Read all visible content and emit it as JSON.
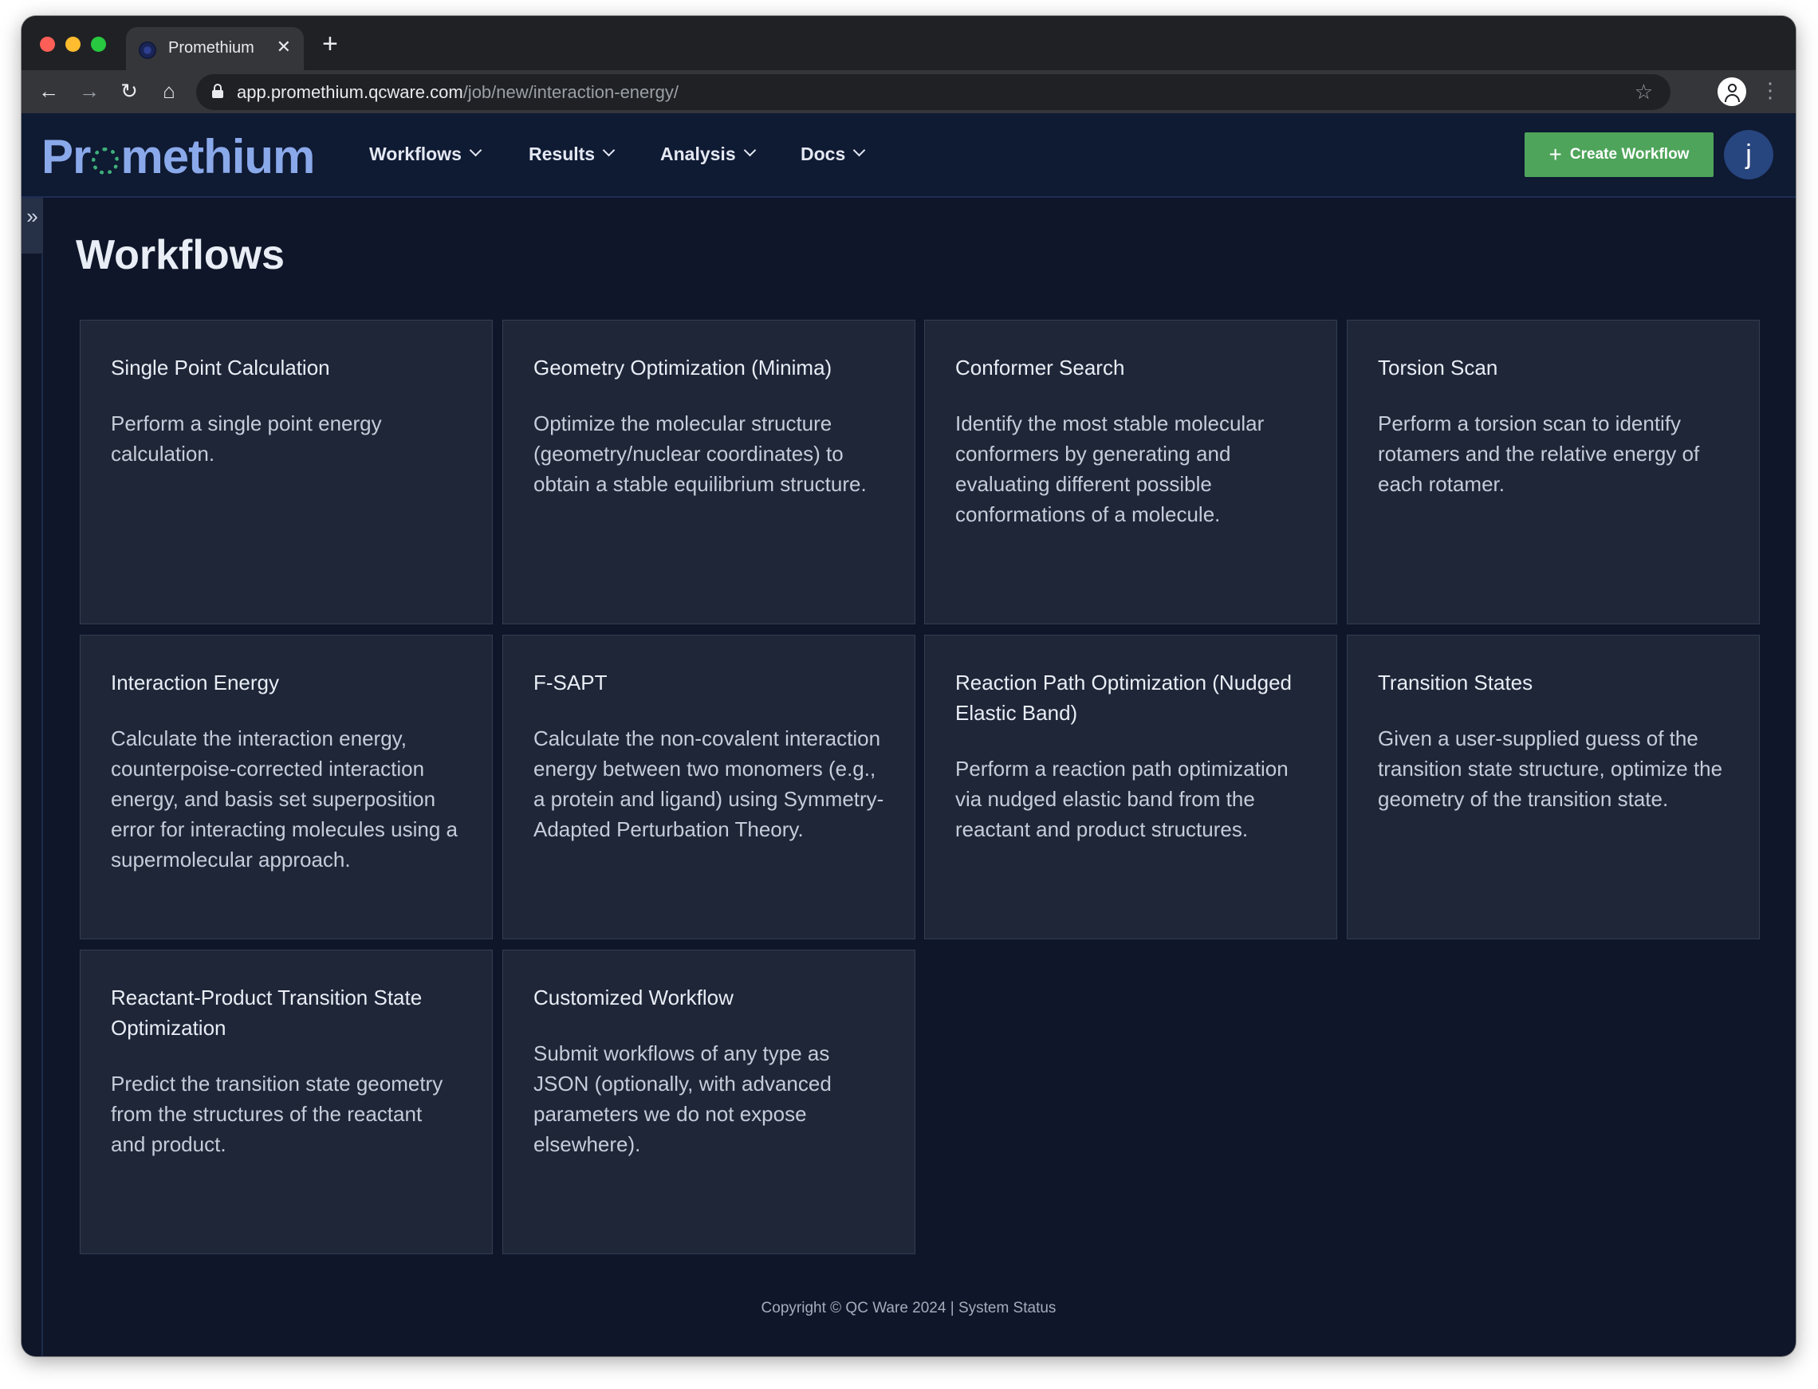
{
  "browser": {
    "tab_title": "Promethium",
    "tab_close": "✕",
    "new_tab": "+",
    "url_host": "app.promethium.qcware.com",
    "url_path": "/job/new/interaction-energy/",
    "icons": [
      "back-arrow-icon",
      "forward-arrow-icon",
      "reload-icon",
      "home-icon",
      "lock-icon",
      "bookmark-star-icon",
      "profile-icon",
      "kebab-menu-icon"
    ]
  },
  "header": {
    "logo_pre": "Pr",
    "logo_post": "methium",
    "menu": [
      {
        "label": "Workflows"
      },
      {
        "label": "Results"
      },
      {
        "label": "Analysis"
      },
      {
        "label": "Docs"
      }
    ],
    "create_button": "Create Workflow",
    "avatar_initial": "j"
  },
  "main": {
    "title": "Workflows",
    "cards": [
      {
        "title": "Single Point Calculation",
        "description": "Perform a single point energy calculation."
      },
      {
        "title": "Geometry Optimization (Minima)",
        "description": "Optimize the molecular structure (geometry/nuclear coordinates) to obtain a stable equilibrium structure."
      },
      {
        "title": "Conformer Search",
        "description": "Identify the most stable molecular conformers by generating and evaluating different possible conformations of a molecule."
      },
      {
        "title": "Torsion Scan",
        "description": "Perform a torsion scan to identify rotamers and the relative energy of each rotamer."
      },
      {
        "title": "Interaction Energy",
        "description": "Calculate the interaction energy, counterpoise-corrected interaction energy, and basis set superposition error for interacting molecules using a supermolecular approach."
      },
      {
        "title": "F-SAPT",
        "description": "Calculate the non-covalent interaction energy between two monomers (e.g., a protein and ligand) using Symmetry-Adapted Perturbation Theory."
      },
      {
        "title": "Reaction Path Optimization (Nudged Elastic Band)",
        "description": "Perform a reaction path optimization via nudged elastic band from the reactant and product structures."
      },
      {
        "title": "Transition States",
        "description": "Given a user-supplied guess of the transition state structure, optimize the geometry of the transition state."
      },
      {
        "title": "Reactant-Product Transition State Optimization",
        "description": "Predict the transition state geometry from the structures of the reactant and product."
      },
      {
        "title": "Customized Workflow",
        "description": "Submit workflows of any type as JSON (optionally, with advanced parameters we do not expose elsewhere)."
      }
    ]
  },
  "footer": {
    "copyright": "Copyright © QC Ware 2024",
    "separator": "|",
    "status_link": "System Status"
  },
  "colors": {
    "accent_green": "#4ea45a",
    "logo_blue": "#8aa9ea",
    "background": "#0f1629",
    "card": "#1e2638"
  }
}
